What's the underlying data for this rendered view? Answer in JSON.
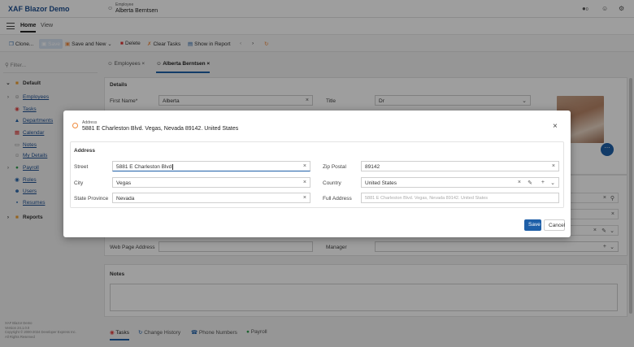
{
  "app": {
    "title": "XAF Blazor Demo"
  },
  "header": {
    "caption": "Employee",
    "name": "Alberta Berntsen",
    "notif_count": "0"
  },
  "menu": {
    "tabs": [
      "Home",
      "View"
    ]
  },
  "toolbar": {
    "clone": "Clone...",
    "save": "Save",
    "save_and_new": "Save and New",
    "delete": "Delete",
    "clear_tasks": "Clear Tasks",
    "show_in_report": "Show in Report"
  },
  "sidebar": {
    "filter_placeholder": "Filter...",
    "default_group": "Default",
    "items": [
      "Employees",
      "Tasks",
      "Departments",
      "Calendar",
      "Notes",
      "My Details",
      "Payroll",
      "Roles",
      "Users",
      "Resumes"
    ],
    "reports_group": "Reports",
    "copyright": [
      "XAF Blazor Demo",
      "Version 24.1.0.0",
      "Copyright © 2000-2024 Developer Express Inc.",
      "All Rights Reserved"
    ]
  },
  "doc_tabs": [
    "Employees",
    "Alberta Berntsen"
  ],
  "details": {
    "section": "Details",
    "first_name_label": "First Name*",
    "first_name": "Alberta",
    "title_label": "Title",
    "title": "Dr",
    "web_page_label": "Web Page Address",
    "manager_label": "Manager",
    "notes_section": "Notes"
  },
  "bottom_tabs": [
    "Tasks",
    "Change History",
    "Phone Numbers",
    "Payroll"
  ],
  "dialog": {
    "caption": "Address",
    "title": "5881 E Charleston Blvd. Vegas, Nevada 89142. United States",
    "group": "Address",
    "street_label": "Street",
    "street": "5881 E Charleston Blvd",
    "zip_label": "Zip Postal",
    "zip": "89142",
    "city_label": "City",
    "city": "Vegas",
    "country_label": "Country",
    "country": "United States",
    "state_label": "State Province",
    "state": "Nevada",
    "full_label": "Full Address",
    "full": "5881 E Charleston Blvd. Vegas, Nevada 89142. United States",
    "save": "Save",
    "cancel": "Cancel"
  },
  "colors": {
    "brand": "#1e4f91",
    "primary": "#1e5fa8",
    "accent": "#f08a3c"
  }
}
